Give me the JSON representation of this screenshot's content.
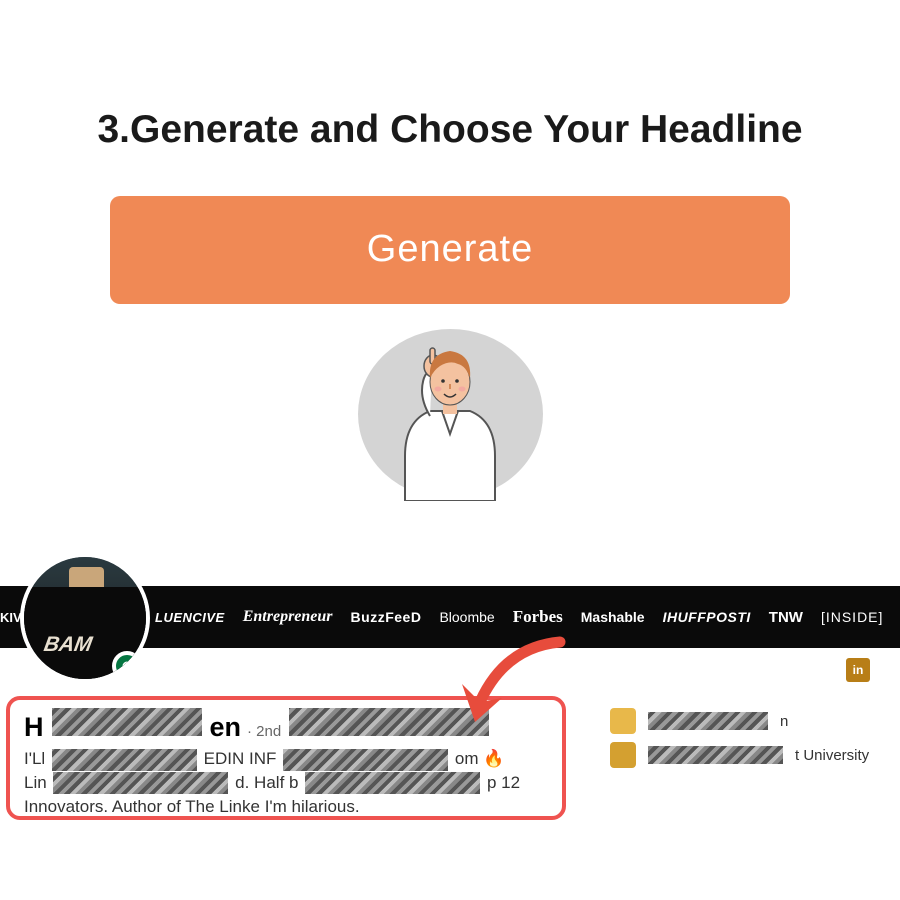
{
  "step_title": "3.Generate and Choose Your Headline",
  "generate_button_label": "Generate",
  "colors": {
    "button_bg": "#f08955",
    "highlight_border": "#ef5350",
    "arrow": "#e74c3c",
    "linkedin_orange": "#b87e17"
  },
  "profile": {
    "shirt_text": "BAM",
    "name_prefix": "H",
    "name_suffix": "en",
    "degree": "· 2nd",
    "headline_parts": {
      "p1": "I'Ll",
      "p2": "EDIN INF",
      "p3": "om 🔥",
      "p4": "Lin",
      "p5": "d. Half b",
      "p6": "p 12",
      "p7": "Innovators. Author of The Linke",
      "p8": "I'm hilarious."
    },
    "side": {
      "row1_suffix": "n",
      "row2_suffix": "t University"
    }
  },
  "media_logos": [
    "KIVO",
    "LUENCIVE",
    "Entrepreneur",
    "BuzzFeeD",
    "Bloombe",
    "Forbes",
    "Mashable",
    "IHUFFPOSTI",
    "TNW",
    "[INSIDE]"
  ],
  "linkedin_label": "in"
}
